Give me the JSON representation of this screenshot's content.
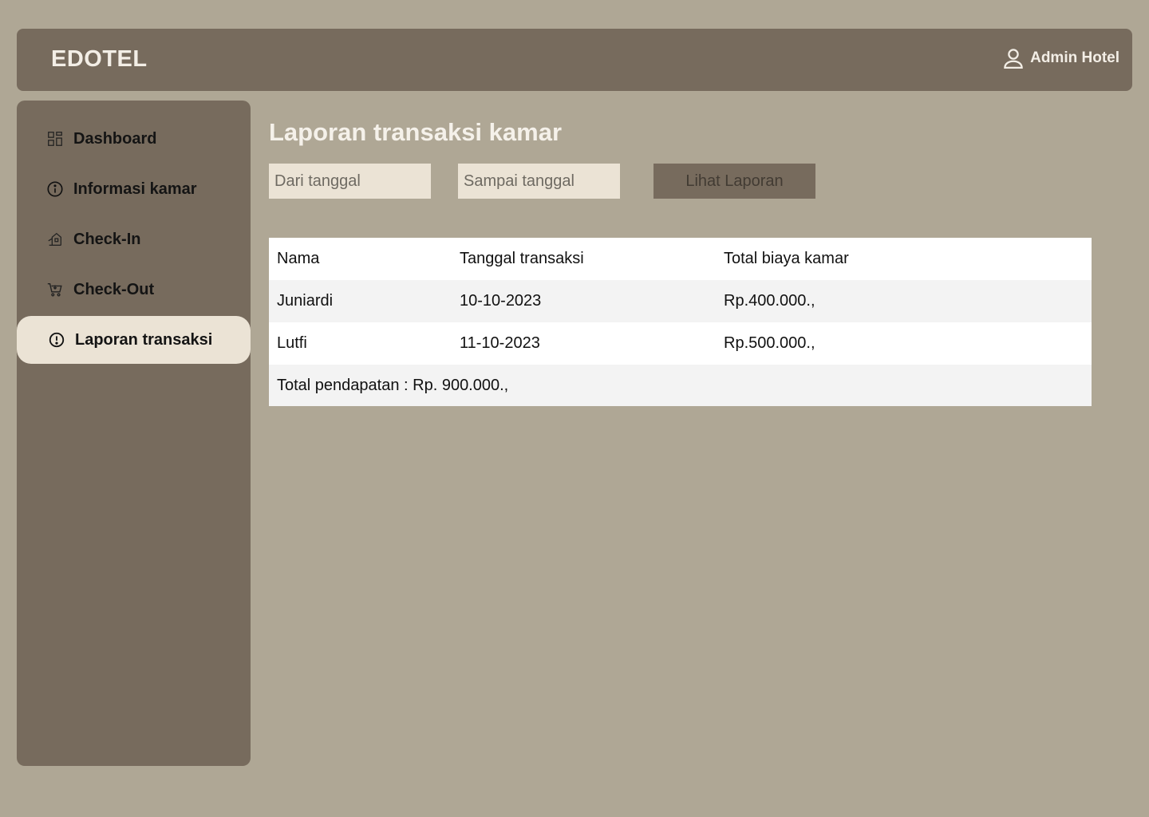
{
  "header": {
    "brand": "EDOTEL",
    "user_label": "Admin Hotel",
    "user_icon": "user-icon"
  },
  "sidebar": {
    "items": [
      {
        "label": "Dashboard",
        "icon": "grid-icon",
        "active": false
      },
      {
        "label": "Informasi kamar",
        "icon": "info-icon",
        "active": false
      },
      {
        "label": "Check-In",
        "icon": "check-in-icon",
        "active": false
      },
      {
        "label": "Check-Out",
        "icon": "cart-icon",
        "active": false
      },
      {
        "label": "Laporan transaksi",
        "icon": "alert-circle-icon",
        "active": true
      }
    ]
  },
  "main": {
    "title": "Laporan transaksi kamar",
    "from_date_placeholder": "Dari tanggal",
    "to_date_placeholder": "Sampai tanggal",
    "view_button_label": "Lihat Laporan",
    "table": {
      "columns": [
        "Nama",
        "Tanggal transaksi",
        "Total biaya kamar"
      ],
      "rows": [
        [
          "Juniardi",
          "10-10-2023",
          "Rp.400.000.,"
        ],
        [
          "Lutfi",
          "11-10-2023",
          "Rp.500.000.,"
        ]
      ],
      "total": "Total pendapatan : Rp. 900.000.,"
    }
  },
  "colors": {
    "background": "#afa795",
    "panel": "#776b5d",
    "active_item": "#ebe3d5",
    "input": "#ebe3d5"
  }
}
